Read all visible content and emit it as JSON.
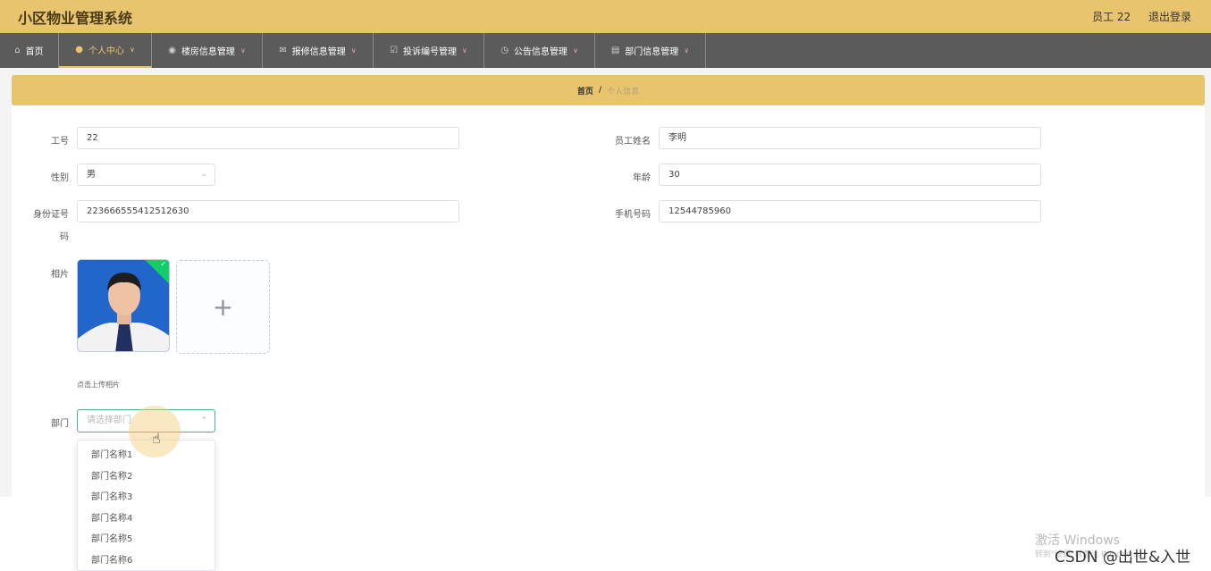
{
  "header": {
    "system_title": "小区物业管理系统",
    "user_label": "员工 22",
    "logout_label": "退出登录"
  },
  "nav": {
    "items": [
      {
        "label": "首页",
        "icon": "home-icon"
      },
      {
        "label": "个人中心",
        "icon": "user-icon"
      },
      {
        "label": "楼房信息管理",
        "icon": "pin-icon"
      },
      {
        "label": "报修信息管理",
        "icon": "mail-icon"
      },
      {
        "label": "投诉编号管理",
        "icon": "envelope-check-icon"
      },
      {
        "label": "公告信息管理",
        "icon": "clock-icon"
      },
      {
        "label": "部门信息管理",
        "icon": "clipboard-icon"
      }
    ],
    "active_index": 1
  },
  "breadcrumb": {
    "home": "首页",
    "separator": "/",
    "current": "个人信息"
  },
  "form": {
    "employee_no": {
      "label": "工号",
      "value": "22"
    },
    "employee_name": {
      "label": "员工姓名",
      "value": "李明"
    },
    "gender": {
      "label": "性别",
      "value": "男"
    },
    "age": {
      "label": "年龄",
      "value": "30"
    },
    "id_number": {
      "label_line1": "身份证号",
      "label_line2": "码",
      "value": "223666555412512630"
    },
    "phone": {
      "label": "手机号码",
      "value": "12544785960"
    },
    "photo": {
      "label": "相片",
      "hint": "点击上传相片"
    },
    "department": {
      "label": "部门",
      "placeholder": "请选择部门",
      "options": [
        "部门名称1",
        "部门名称2",
        "部门名称3",
        "部门名称4",
        "部门名称5",
        "部门名称6"
      ]
    }
  },
  "overlay": {
    "watermark_line1": "激活 Windows",
    "watermark_line2": "转到\"设置\"以激活 Windows。",
    "csdn_label": "CSDN @出世&入世"
  },
  "colors": {
    "header_bg": "#e9c46e",
    "nav_bg": "#5b5b5b",
    "active_accent": "#e9c46e",
    "select_border": "#4caf8f",
    "upload_success": "#13ce66"
  }
}
